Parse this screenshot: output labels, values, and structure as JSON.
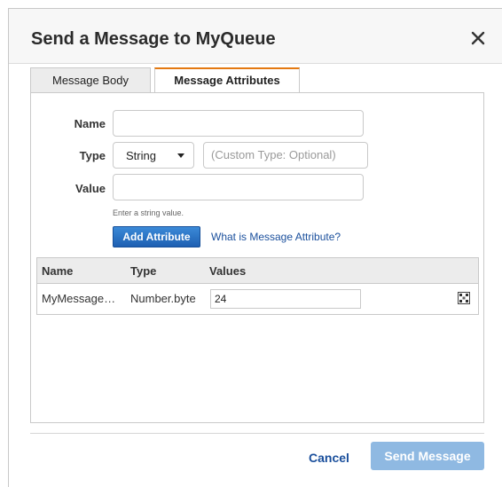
{
  "dialog": {
    "title": "Send a Message to MyQueue",
    "close_icon": "close-icon"
  },
  "tabs": [
    {
      "label": "Message Body",
      "active": false
    },
    {
      "label": "Message Attributes",
      "active": true
    }
  ],
  "form": {
    "name_label": "Name",
    "name_value": "",
    "type_label": "Type",
    "type_selected": "String",
    "custom_type_placeholder": "(Custom Type: Optional)",
    "value_label": "Value",
    "value_value": "",
    "hint": "Enter a string value.",
    "add_button": "Add Attribute",
    "help_link": "What is Message Attribute?"
  },
  "table": {
    "headers": [
      "Name",
      "Type",
      "Values"
    ],
    "rows": [
      {
        "name": "MyMessage…",
        "type": "Number.byte",
        "value": "24",
        "action_icon": "remove-icon"
      }
    ]
  },
  "footer": {
    "cancel": "Cancel",
    "send": "Send Message"
  },
  "colors": {
    "accent_tab": "#e47911",
    "primary_button": "#1e5fb2",
    "disabled_button": "#8fb9e2",
    "link": "#1a4f9c"
  }
}
